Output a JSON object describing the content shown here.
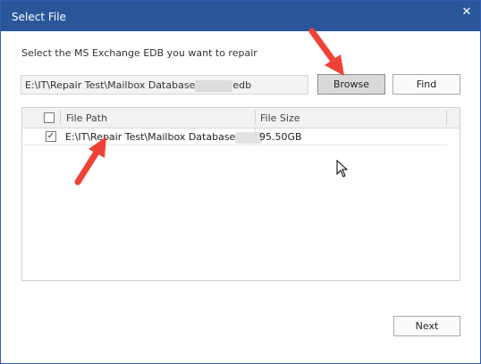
{
  "window": {
    "title": "Select File",
    "close_glyph": "✕"
  },
  "prompt": "Select the MS Exchange EDB you want to repair",
  "path_field": {
    "value_prefix": "E:\\IT\\Repair Test\\Mailbox Database",
    "value_suffix": "edb"
  },
  "buttons": {
    "browse": "Browse",
    "find": "Find",
    "next": "Next"
  },
  "file_list": {
    "columns": [
      "File Path",
      "File Size"
    ],
    "rows": [
      {
        "checked": true,
        "check_glyph": "✓",
        "path": "E:\\IT\\Repair Test\\Mailbox Database",
        "size": "95.50GB"
      }
    ]
  },
  "colors": {
    "titlebar": "#2b579a",
    "annotation_arrow": "#ef4136"
  },
  "icons": {
    "close": "close-icon",
    "arrow": "red-arrow-annotation",
    "cursor": "mouse-cursor-icon"
  }
}
